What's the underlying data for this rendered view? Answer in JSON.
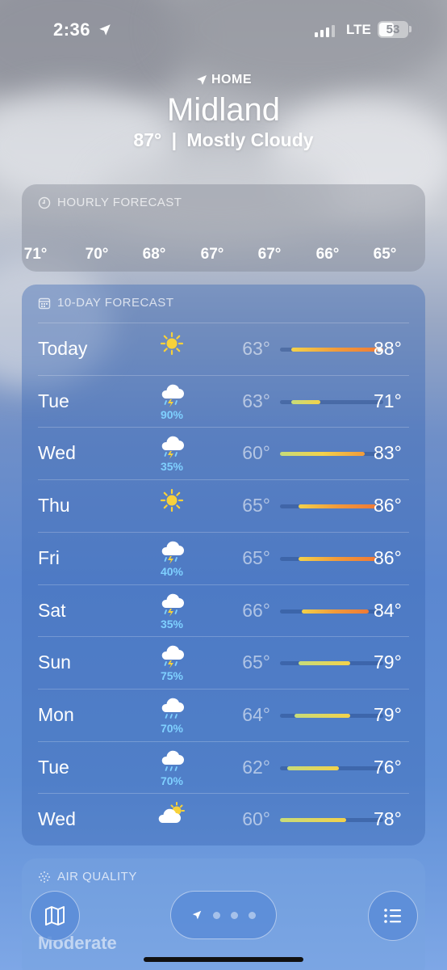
{
  "status_bar": {
    "time": "2:36",
    "network": "LTE",
    "battery": "53",
    "battery_level": 0.53
  },
  "header": {
    "location_label": "HOME",
    "city": "Midland",
    "temperature": "87°",
    "separator": "|",
    "condition": "Mostly Cloudy"
  },
  "hourly_forecast": {
    "title": "HOURLY FORECAST",
    "temps": [
      "71°",
      "70°",
      "68°",
      "67°",
      "67°",
      "66°",
      "65°"
    ]
  },
  "ten_day_forecast": {
    "title": "10-DAY FORECAST",
    "range_min": 60,
    "range_max": 88,
    "days": [
      {
        "day": "Today",
        "icon": "sun-icon",
        "precip": "",
        "low": "63°",
        "high": "88°",
        "low_val": 63,
        "high_val": 88,
        "current": 87
      },
      {
        "day": "Tue",
        "icon": "thunderstorm-icon",
        "precip": "90%",
        "low": "63°",
        "high": "71°",
        "low_val": 63,
        "high_val": 71
      },
      {
        "day": "Wed",
        "icon": "thunderstorm-icon",
        "precip": "35%",
        "low": "60°",
        "high": "83°",
        "low_val": 60,
        "high_val": 83
      },
      {
        "day": "Thu",
        "icon": "sun-icon",
        "precip": "",
        "low": "65°",
        "high": "86°",
        "low_val": 65,
        "high_val": 86
      },
      {
        "day": "Fri",
        "icon": "thunderstorm-icon",
        "precip": "40%",
        "low": "65°",
        "high": "86°",
        "low_val": 65,
        "high_val": 86
      },
      {
        "day": "Sat",
        "icon": "thunderstorm-icon",
        "precip": "35%",
        "low": "66°",
        "high": "84°",
        "low_val": 66,
        "high_val": 84
      },
      {
        "day": "Sun",
        "icon": "thunderstorm-icon",
        "precip": "75%",
        "low": "65°",
        "high": "79°",
        "low_val": 65,
        "high_val": 79
      },
      {
        "day": "Mon",
        "icon": "rain-icon",
        "precip": "70%",
        "low": "64°",
        "high": "79°",
        "low_val": 64,
        "high_val": 79
      },
      {
        "day": "Tue",
        "icon": "rain-icon",
        "precip": "70%",
        "low": "62°",
        "high": "76°",
        "low_val": 62,
        "high_val": 76
      },
      {
        "day": "Wed",
        "icon": "partly-sunny-icon",
        "precip": "",
        "low": "60°",
        "high": "78°",
        "low_val": 60,
        "high_val": 78
      }
    ]
  },
  "air_quality": {
    "title": "AIR QUALITY",
    "value": "Moderate"
  },
  "colors": {
    "cool": "#c7dc7a",
    "mild": "#f3d24a",
    "warm": "#f29a3a",
    "hot": "#ef7a36",
    "precip": "#7fd0ff"
  }
}
